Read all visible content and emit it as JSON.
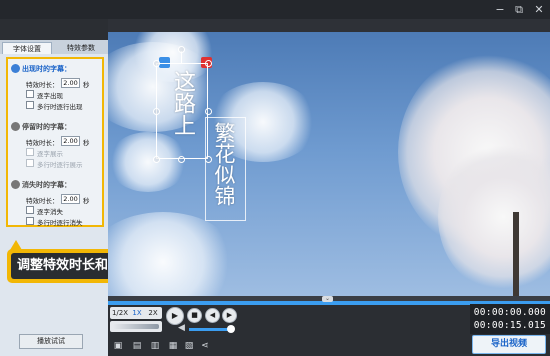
{
  "window": {
    "minimize": "−",
    "restore": "⧉",
    "close": "✕"
  },
  "tabs": [
    {
      "label": "字体设置",
      "active": true
    },
    {
      "label": "特效参数",
      "active": false
    }
  ],
  "sections": [
    {
      "title": "出现时的字幕：",
      "style": "active",
      "duration_label": "特效时长：",
      "duration_value": "2.00",
      "unit": "秒",
      "options": [
        {
          "label": "逐字出现",
          "checked": false,
          "enabled": true
        },
        {
          "label": "多行时逐行出现",
          "checked": false,
          "enabled": true
        }
      ]
    },
    {
      "title": "停留时的字幕：",
      "style": "inactive",
      "duration_label": "特效时长：",
      "duration_value": "2.00",
      "unit": "秒",
      "options": [
        {
          "label": "逐字展示",
          "checked": false,
          "enabled": false
        },
        {
          "label": "多行时逐行展示",
          "checked": false,
          "enabled": false
        }
      ]
    },
    {
      "title": "消失时的字幕：",
      "style": "inactive",
      "duration_label": "特效时长：",
      "duration_value": "2.00",
      "unit": "秒",
      "options": [
        {
          "label": "逐字消失",
          "checked": false,
          "enabled": true
        },
        {
          "label": "多行时逐行消失",
          "checked": false,
          "enabled": true
        }
      ]
    }
  ],
  "callout_text": "调整特效时长和速度",
  "preview_button": "播放试试",
  "subtitle": {
    "line1": "这路上",
    "line2": "繁花似锦"
  },
  "speed": {
    "options": [
      "1/2X",
      "1X",
      "2X"
    ],
    "selected": "1X"
  },
  "controls": {
    "play": "▶",
    "stop": "■",
    "prev": "◀",
    "next": "▶",
    "volume_fraction": 0.95
  },
  "time": {
    "current": "00:00:00.000",
    "total": "00:00:15.015"
  },
  "export_label": "导出视频",
  "colors": {
    "accent": "#f2b705",
    "blue": "#1a63c8",
    "timeline": "#3b9df0"
  }
}
